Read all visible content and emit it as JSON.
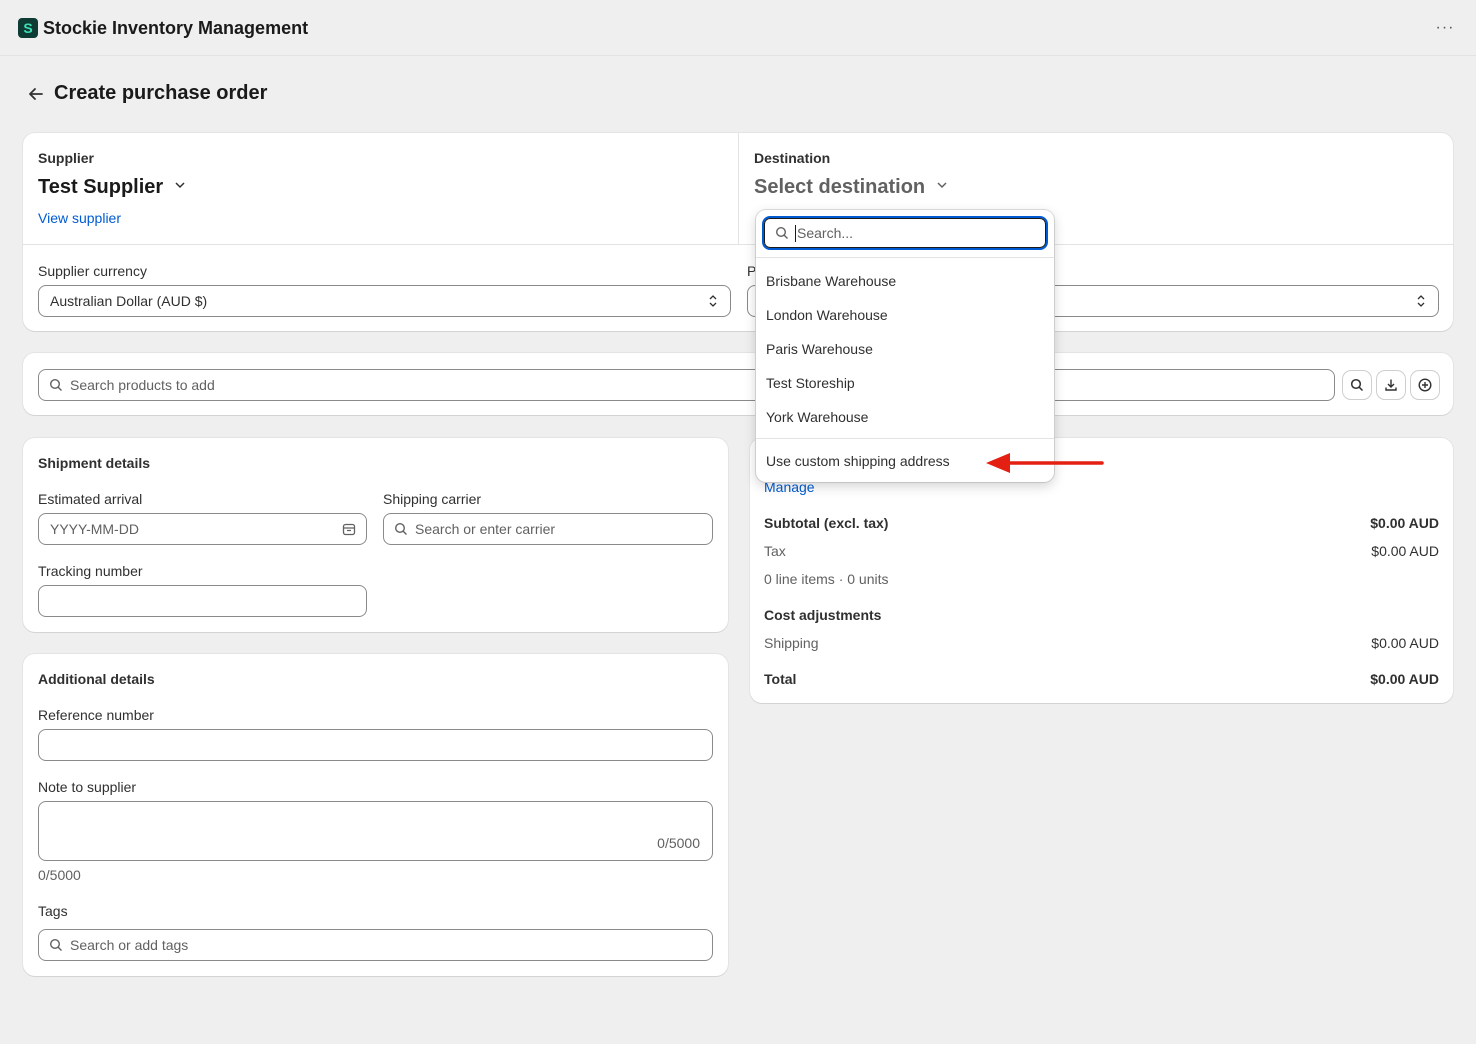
{
  "app": {
    "title": "Stockie Inventory Management",
    "logo_letter": "S",
    "more": "···"
  },
  "page": {
    "title": "Create purchase order"
  },
  "supplier": {
    "label": "Supplier",
    "name": "Test Supplier",
    "view_link": "View supplier"
  },
  "destination": {
    "label": "Destination",
    "placeholder": "Select destination"
  },
  "currency": {
    "label": "Supplier currency",
    "value": "Australian Dollar (AUD $)",
    "hidden_label_fragment": "P"
  },
  "product_search": {
    "placeholder": "Search products to add"
  },
  "shipment": {
    "title": "Shipment details",
    "arrival_label": "Estimated arrival",
    "arrival_placeholder": "YYYY-MM-DD",
    "carrier_label": "Shipping carrier",
    "carrier_placeholder": "Search or enter carrier",
    "tracking_label": "Tracking number"
  },
  "additional": {
    "title": "Additional details",
    "reference_label": "Reference number",
    "note_label": "Note to supplier",
    "note_counter_inside": "0/5000",
    "note_counter_below": "0/5000",
    "tags_label": "Tags",
    "tags_placeholder": "Search or add tags"
  },
  "summary": {
    "manage_link": "Manage",
    "subtotal_label": "Subtotal (excl. tax)",
    "subtotal_value": "$0.00 AUD",
    "tax_label": "Tax",
    "tax_value": "$0.00 AUD",
    "items_text": "0 line items · 0 units",
    "adjustments_label": "Cost adjustments",
    "shipping_label": "Shipping",
    "shipping_value": "$0.00 AUD",
    "total_label": "Total",
    "total_value": "$0.00 AUD"
  },
  "dropdown": {
    "search_placeholder": "Search...",
    "options": [
      "Brisbane Warehouse",
      "London Warehouse",
      "Paris Warehouse",
      "Test Storeship",
      "York Warehouse"
    ],
    "custom_address": "Use custom shipping address"
  },
  "colors": {
    "link": "#005bd3",
    "annotation_arrow": "#e32012",
    "focus": "#005bd3"
  }
}
